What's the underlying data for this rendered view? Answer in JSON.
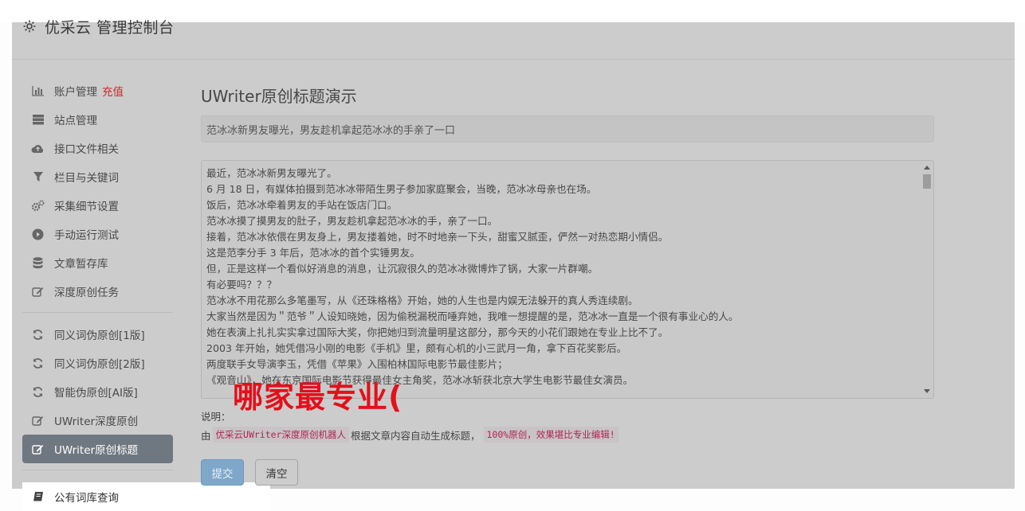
{
  "header": {
    "brand": "优采云 管理控制台",
    "icon": "gear-icon"
  },
  "sidebar": {
    "items": [
      {
        "label": "账户管理",
        "badge": "充值",
        "icon": "bar-chart-icon"
      },
      {
        "label": "站点管理",
        "icon": "server-icon"
      },
      {
        "label": "接口文件相关",
        "icon": "cloud-upload-icon"
      },
      {
        "label": "栏目与关键词",
        "icon": "filter-icon"
      },
      {
        "label": "采集细节设置",
        "icon": "cogs-icon"
      },
      {
        "label": "手动运行测试",
        "icon": "play-circle-icon"
      },
      {
        "label": "文章暂存库",
        "icon": "database-icon"
      },
      {
        "label": "深度原创任务",
        "icon": "edit-icon"
      }
    ],
    "group2": [
      {
        "label": "同义词伪原创[1版]",
        "icon": "refresh-icon"
      },
      {
        "label": "同义词伪原创[2版]",
        "icon": "refresh-icon"
      },
      {
        "label": "智能伪原创[AI版]",
        "icon": "refresh-icon"
      },
      {
        "label": "UWriter深度原创",
        "icon": "edit-icon"
      },
      {
        "label": "UWriter原创标题",
        "icon": "edit-icon",
        "active": true
      }
    ],
    "outside_item": {
      "label": "公有词库查询",
      "icon": "book-icon"
    }
  },
  "main": {
    "title": "UWriter原创标题演示",
    "title_input_value": "范冰冰新男友曝光，男友趁机拿起范冰冰的手亲了一口",
    "content_lines": [
      "最近，范冰冰新男友曝光了。",
      "6 月 18 日，有媒体拍摄到范冰冰带陌生男子参加家庭聚会，当晚，范冰冰母亲也在场。",
      "饭后，范冰冰牵着男友的手站在饭店门口。",
      "范冰冰摸了摸男友的肚子，男友趁机拿起范冰冰的手，亲了一口。",
      "接着，范冰冰依偎在男友身上，男友搂着她，时不时地亲一下头，甜蜜又腻歪，俨然一对热恋期小情侣。",
      "这是范李分手 3 年后，范冰冰的首个实锤男友。",
      "但，正是这样一个看似好消息的消息，让沉寂很久的范冰冰微博炸了锅，大家一片群嘲。",
      "有必要吗？？？",
      "范冰冰不用花那么多笔墨写，从《还珠格格》开始，她的人生也是内娱无法躲开的真人秀连续剧。",
      "大家当然是因为＂范爷＂人设知晓她，因为偷税漏税而唾弃她，我唯一想提醒的是，范冰冰一直是一个很有事业心的人。",
      "她在表演上扎扎实实拿过国际大奖，你把她归到流量明星这部分，那今天的小花们跟她在专业上比不了。",
      "2003 年开始，她凭借冯小刚的电影《手机》里，颇有心机的小三武月一角，拿下百花奖影后。",
      "两度联手女导演李玉，凭借《苹果》入围柏林国际电影节最佳影片；",
      "《观音山》，她在东京国际电影节获得最佳女主角奖，范冰冰斩获北京大学生电影节最佳女演员。"
    ],
    "overlay_text": "哪家最专业(",
    "note_label": "说明：",
    "note_prefix": "由",
    "note_code1": "优采云UWriter深度原创机器人",
    "note_middle": "根据文章内容自动生成标题，",
    "note_code2": "100%原创，效果堪比专业编辑!",
    "submit_label": "提交",
    "clear_label": "清空"
  }
}
